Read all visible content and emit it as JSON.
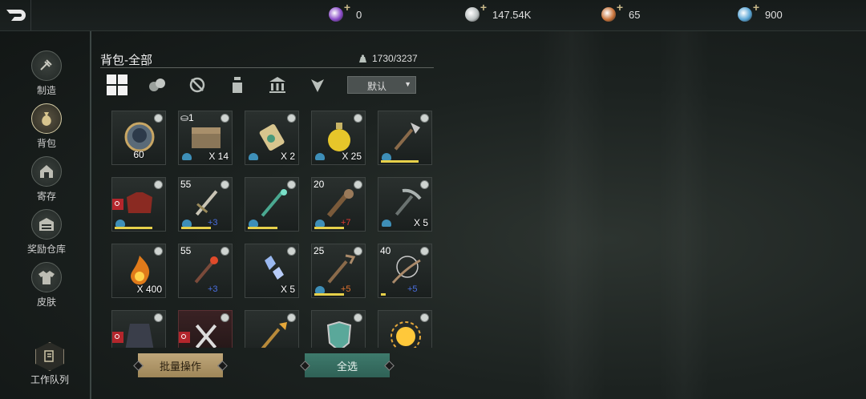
{
  "currencies": [
    {
      "icon": "purple-gem-icon",
      "color": "#8a4bc8",
      "value": "0"
    },
    {
      "icon": "silver-coin-icon",
      "color": "#b9bfbf",
      "value": "147.54K"
    },
    {
      "icon": "copper-coin-icon",
      "color": "#c8733a",
      "value": "65"
    },
    {
      "icon": "blue-orb-icon",
      "color": "#5aa6d6",
      "value": "900"
    }
  ],
  "sidebar": {
    "items": [
      {
        "label": "制造",
        "icon": "craft-icon"
      },
      {
        "label": "背包",
        "icon": "bag-icon"
      },
      {
        "label": "寄存",
        "icon": "storage-icon"
      },
      {
        "label": "奖励仓库",
        "icon": "reward-warehouse-icon"
      },
      {
        "label": "皮肤",
        "icon": "skin-icon"
      }
    ],
    "work_queue_label": "工作队列"
  },
  "panel": {
    "title": "背包-全部",
    "capacity": "1730/3237",
    "sort_value": "默认"
  },
  "items": [
    {
      "art": "medal",
      "qty": "60",
      "qty_center": true,
      "lock": true,
      "dura": 0
    },
    {
      "art": "chest",
      "lvl": "⛀1",
      "qty": "X 14",
      "lock": true,
      "bind": true,
      "dura": 0
    },
    {
      "art": "scroll",
      "qty": "X 2",
      "lock": true,
      "bind": true,
      "dura": 0
    },
    {
      "art": "potion",
      "qty": "X 25",
      "lock": true,
      "bind": true,
      "dura": 0
    },
    {
      "art": "axe",
      "lock": true,
      "bind": true,
      "dura": 0.75
    },
    {
      "art": "chestplate",
      "lock": true,
      "bind": true,
      "tag": true,
      "dura": 0.75
    },
    {
      "art": "sword",
      "lvl": "55",
      "plus": "+3",
      "plus_color": "#4a6fe0",
      "lock": true,
      "bind": true,
      "dura": 0.6
    },
    {
      "art": "staff-green",
      "lock": true,
      "bind": true,
      "dura": 0.6
    },
    {
      "art": "club",
      "lvl": "20",
      "plus": "+7",
      "plus_color": "#e03a32",
      "lock": true,
      "bind": true,
      "dura": 0.6
    },
    {
      "art": "pickaxe",
      "qty": "X 5",
      "lock": true,
      "bind": true,
      "dura": 0
    },
    {
      "art": "fire",
      "qty": "X 400",
      "lock": true,
      "dura": 0
    },
    {
      "art": "staff-red",
      "lvl": "55",
      "plus": "+3",
      "plus_color": "#4a6fe0",
      "lock": true,
      "dura": 0
    },
    {
      "art": "crystal",
      "qty": "X 5",
      "lock": true,
      "dura": 0
    },
    {
      "art": "fork-staff",
      "lvl": "25",
      "plus": "+5",
      "plus_color": "#e0722e",
      "lock": true,
      "bind": true,
      "dura": 0.6
    },
    {
      "art": "web-bow",
      "lvl": "40",
      "plus": "+5",
      "plus_color": "#4a6fe0",
      "lock": true,
      "dura": 0.1
    },
    {
      "art": "cloak",
      "lock": true,
      "tag": true,
      "dura": 0
    },
    {
      "art": "tools",
      "lock": true,
      "tag": true,
      "red": true,
      "dura": 0
    },
    {
      "art": "spear",
      "lock": true,
      "dura": 0
    },
    {
      "art": "shield",
      "lock": true,
      "dura": 0
    },
    {
      "art": "sun",
      "lock": true,
      "dura": 0
    }
  ],
  "buttons": {
    "batch": "批量操作",
    "select_all": "全选"
  }
}
